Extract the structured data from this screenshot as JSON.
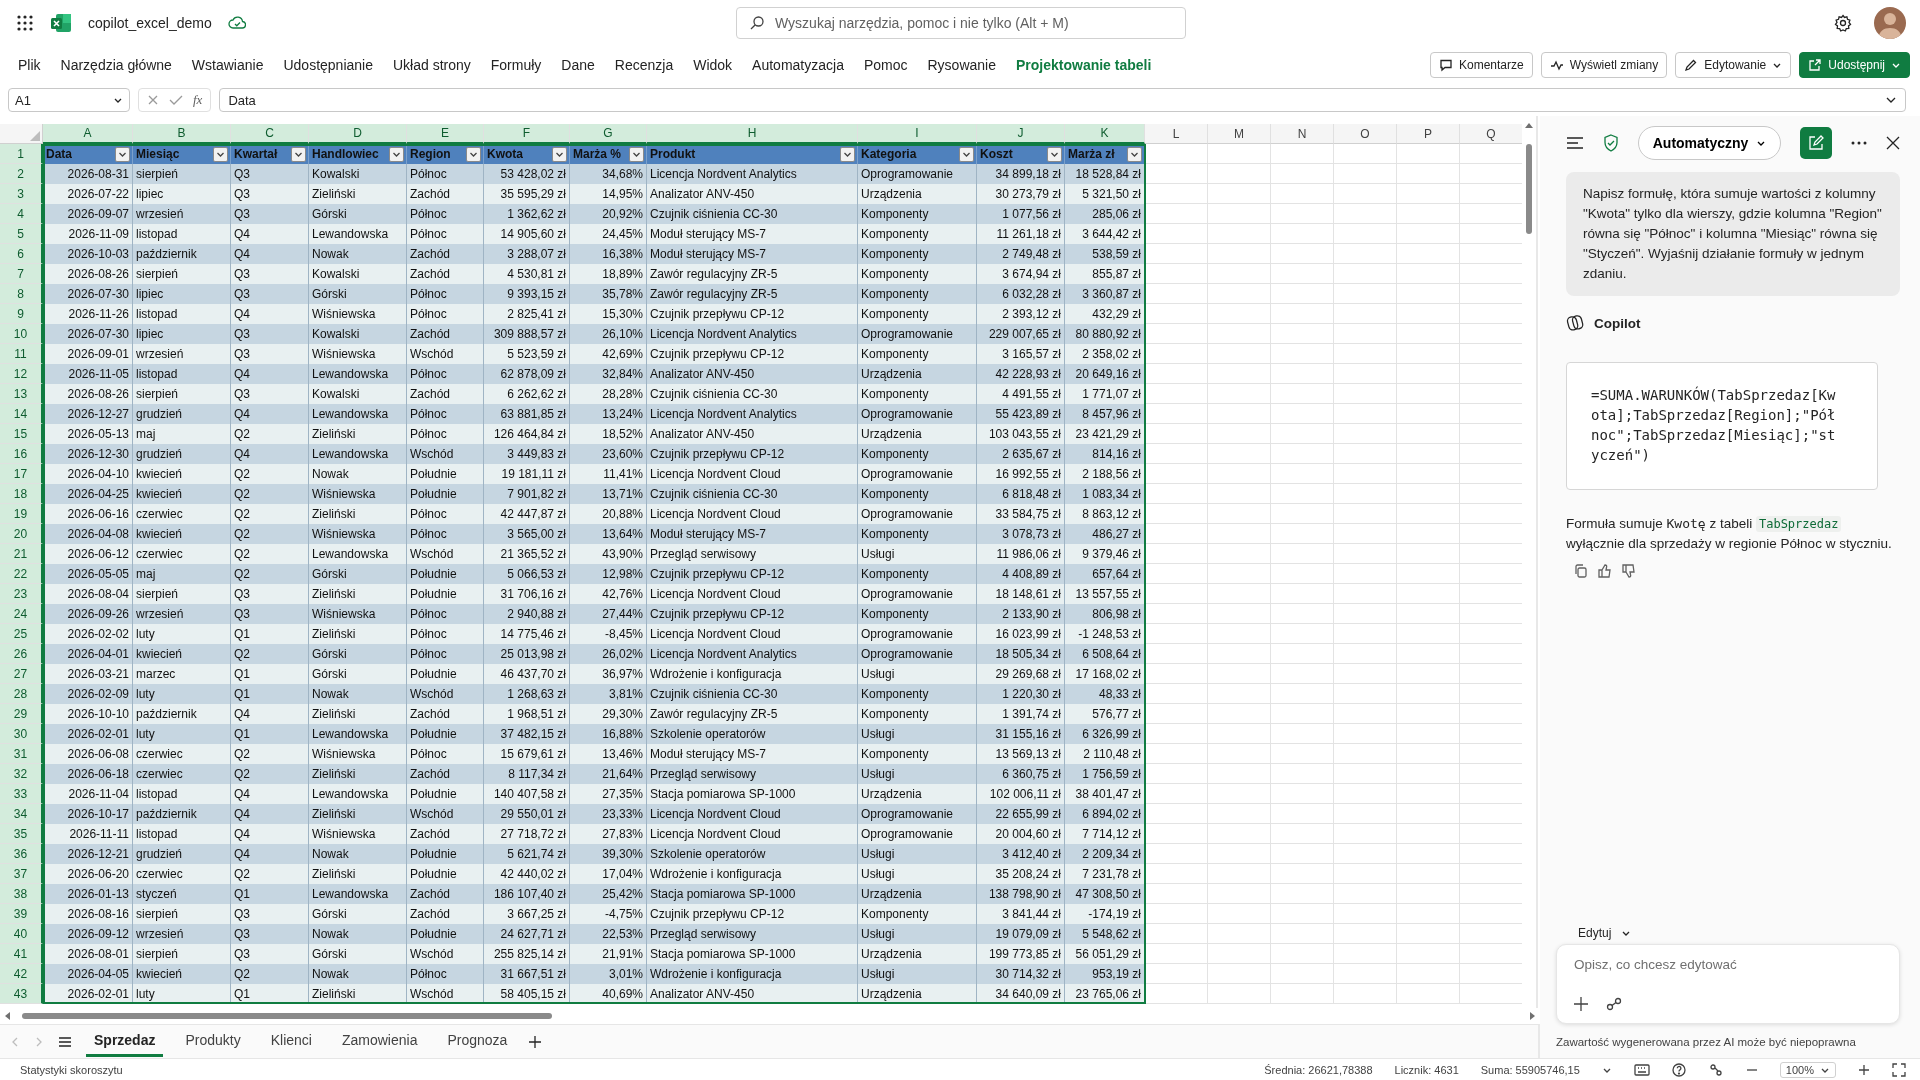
{
  "app": {
    "title": "copilot_excel_demo",
    "search_placeholder": "Wyszukaj narzędzia, pomoc i nie tylko (Alt + M)"
  },
  "ribbon_tabs": [
    {
      "label": "Plik",
      "contextual": false
    },
    {
      "label": "Narzędzia główne",
      "contextual": false
    },
    {
      "label": "Wstawianie",
      "contextual": false
    },
    {
      "label": "Udostępnianie",
      "contextual": false
    },
    {
      "label": "Układ strony",
      "contextual": false
    },
    {
      "label": "Formuły",
      "contextual": false
    },
    {
      "label": "Dane",
      "contextual": false
    },
    {
      "label": "Recenzja",
      "contextual": false
    },
    {
      "label": "Widok",
      "contextual": false
    },
    {
      "label": "Automatyzacja",
      "contextual": false
    },
    {
      "label": "Pomoc",
      "contextual": false
    },
    {
      "label": "Rysowanie",
      "contextual": false
    },
    {
      "label": "Projektowanie tabeli",
      "contextual": true
    }
  ],
  "ribbon_buttons": [
    {
      "label": "Komentarze",
      "kind": "comments",
      "primary": false,
      "dropdown": false
    },
    {
      "label": "Wyświetl zmiany",
      "kind": "changes",
      "primary": false,
      "dropdown": false
    },
    {
      "label": "Edytowanie",
      "kind": "editing",
      "primary": false,
      "dropdown": true
    },
    {
      "label": "Udostępnij",
      "kind": "share",
      "primary": true,
      "dropdown": true
    }
  ],
  "formula_bar": {
    "name_box": "A1",
    "function_label": "fx",
    "formula": "Data"
  },
  "grid": {
    "columns": [
      {
        "label": "A",
        "selected": true
      },
      {
        "label": "B",
        "selected": true
      },
      {
        "label": "C",
        "selected": true
      },
      {
        "label": "D",
        "selected": true
      },
      {
        "label": "E",
        "selected": true
      },
      {
        "label": "F",
        "selected": true
      },
      {
        "label": "G",
        "selected": true
      },
      {
        "label": "H",
        "selected": true
      },
      {
        "label": "I",
        "selected": true
      },
      {
        "label": "J",
        "selected": true
      },
      {
        "label": "K",
        "selected": true
      },
      {
        "label": "L",
        "selected": false
      },
      {
        "label": "M",
        "selected": false
      },
      {
        "label": "N",
        "selected": false
      },
      {
        "label": "O",
        "selected": false
      },
      {
        "label": "P",
        "selected": false
      },
      {
        "label": "Q",
        "selected": false
      }
    ],
    "row_numbers": [
      {
        "label": "1",
        "selected": true
      },
      {
        "label": "2",
        "selected": true
      },
      {
        "label": "3",
        "selected": true
      },
      {
        "label": "4",
        "selected": true
      },
      {
        "label": "5",
        "selected": true
      },
      {
        "label": "6",
        "selected": true
      },
      {
        "label": "7",
        "selected": true
      },
      {
        "label": "8",
        "selected": true
      },
      {
        "label": "9",
        "selected": true
      },
      {
        "label": "10",
        "selected": true
      },
      {
        "label": "11",
        "selected": true
      },
      {
        "label": "12",
        "selected": true
      },
      {
        "label": "13",
        "selected": true
      },
      {
        "label": "14",
        "selected": true
      },
      {
        "label": "15",
        "selected": true
      },
      {
        "label": "16",
        "selected": true
      },
      {
        "label": "17",
        "selected": true
      },
      {
        "label": "18",
        "selected": true
      },
      {
        "label": "19",
        "selected": true
      },
      {
        "label": "20",
        "selected": true
      },
      {
        "label": "21",
        "selected": true
      },
      {
        "label": "22",
        "selected": true
      },
      {
        "label": "23",
        "selected": true
      },
      {
        "label": "24",
        "selected": true
      },
      {
        "label": "25",
        "selected": true
      },
      {
        "label": "26",
        "selected": true
      },
      {
        "label": "27",
        "selected": true
      },
      {
        "label": "28",
        "selected": true
      },
      {
        "label": "29",
        "selected": true
      },
      {
        "label": "30",
        "selected": true
      },
      {
        "label": "31",
        "selected": true
      },
      {
        "label": "32",
        "selected": true
      },
      {
        "label": "33",
        "selected": true
      },
      {
        "label": "34",
        "selected": true
      },
      {
        "label": "35",
        "selected": true
      },
      {
        "label": "36",
        "selected": true
      },
      {
        "label": "37",
        "selected": true
      },
      {
        "label": "38",
        "selected": true
      },
      {
        "label": "39",
        "selected": true
      },
      {
        "label": "40",
        "selected": true
      },
      {
        "label": "41",
        "selected": true
      },
      {
        "label": "42",
        "selected": true
      },
      {
        "label": "43",
        "selected": true
      }
    ]
  },
  "table": {
    "headers": [
      "Data",
      "Miesiąc",
      "Kwartał",
      "Handlowiec",
      "Region",
      "Kwota",
      "Marża %",
      "Produkt",
      "Kategoria",
      "Koszt",
      "Marża zł"
    ],
    "rows": [
      [
        "2026-08-31",
        "sierpień",
        "Q3",
        "Kowalski",
        "Północ",
        "53 428,02 zł",
        "34,68%",
        "Licencja Nordvent Analytics",
        "Oprogramowanie",
        "34 899,18 zł",
        "18 528,84 zł"
      ],
      [
        "2026-07-22",
        "lipiec",
        "Q3",
        "Zieliński",
        "Zachód",
        "35 595,29 zł",
        "14,95%",
        "Analizator ANV-450",
        "Urządzenia",
        "30 273,79 zł",
        "5 321,50 zł"
      ],
      [
        "2026-09-07",
        "wrzesień",
        "Q3",
        "Górski",
        "Północ",
        "1 362,62 zł",
        "20,92%",
        "Czujnik ciśnienia CC-30",
        "Komponenty",
        "1 077,56 zł",
        "285,06 zł"
      ],
      [
        "2026-11-09",
        "listopad",
        "Q4",
        "Lewandowska",
        "Północ",
        "14 905,60 zł",
        "24,45%",
        "Moduł sterujący MS-7",
        "Komponenty",
        "11 261,18 zł",
        "3 644,42 zł"
      ],
      [
        "2026-10-03",
        "październik",
        "Q4",
        "Nowak",
        "Zachód",
        "3 288,07 zł",
        "16,38%",
        "Moduł sterujący MS-7",
        "Komponenty",
        "2 749,48 zł",
        "538,59 zł"
      ],
      [
        "2026-08-26",
        "sierpień",
        "Q3",
        "Kowalski",
        "Zachód",
        "4 530,81 zł",
        "18,89%",
        "Zawór regulacyjny ZR-5",
        "Komponenty",
        "3 674,94 zł",
        "855,87 zł"
      ],
      [
        "2026-07-30",
        "lipiec",
        "Q3",
        "Górski",
        "Północ",
        "9 393,15 zł",
        "35,78%",
        "Zawór regulacyjny ZR-5",
        "Komponenty",
        "6 032,28 zł",
        "3 360,87 zł"
      ],
      [
        "2026-11-26",
        "listopad",
        "Q4",
        "Wiśniewska",
        "Północ",
        "2 825,41 zł",
        "15,30%",
        "Czujnik przepływu CP-12",
        "Komponenty",
        "2 393,12 zł",
        "432,29 zł"
      ],
      [
        "2026-07-30",
        "lipiec",
        "Q3",
        "Kowalski",
        "Zachód",
        "309 888,57 zł",
        "26,10%",
        "Licencja Nordvent Analytics",
        "Oprogramowanie",
        "229 007,65 zł",
        "80 880,92 zł"
      ],
      [
        "2026-09-01",
        "wrzesień",
        "Q3",
        "Wiśniewska",
        "Wschód",
        "5 523,59 zł",
        "42,69%",
        "Czujnik przepływu CP-12",
        "Komponenty",
        "3 165,57 zł",
        "2 358,02 zł"
      ],
      [
        "2026-11-05",
        "listopad",
        "Q4",
        "Lewandowska",
        "Północ",
        "62 878,09 zł",
        "32,84%",
        "Analizator ANV-450",
        "Urządzenia",
        "42 228,93 zł",
        "20 649,16 zł"
      ],
      [
        "2026-08-26",
        "sierpień",
        "Q3",
        "Kowalski",
        "Zachód",
        "6 262,62 zł",
        "28,28%",
        "Czujnik ciśnienia CC-30",
        "Komponenty",
        "4 491,55 zł",
        "1 771,07 zł"
      ],
      [
        "2026-12-27",
        "grudzień",
        "Q4",
        "Lewandowska",
        "Północ",
        "63 881,85 zł",
        "13,24%",
        "Licencja Nordvent Analytics",
        "Oprogramowanie",
        "55 423,89 zł",
        "8 457,96 zł"
      ],
      [
        "2026-05-13",
        "maj",
        "Q2",
        "Zieliński",
        "Północ",
        "126 464,84 zł",
        "18,52%",
        "Analizator ANV-450",
        "Urządzenia",
        "103 043,55 zł",
        "23 421,29 zł"
      ],
      [
        "2026-12-30",
        "grudzień",
        "Q4",
        "Lewandowska",
        "Wschód",
        "3 449,83 zł",
        "23,60%",
        "Czujnik przepływu CP-12",
        "Komponenty",
        "2 635,67 zł",
        "814,16 zł"
      ],
      [
        "2026-04-10",
        "kwiecień",
        "Q2",
        "Nowak",
        "Południe",
        "19 181,11 zł",
        "11,41%",
        "Licencja Nordvent Cloud",
        "Oprogramowanie",
        "16 992,55 zł",
        "2 188,56 zł"
      ],
      [
        "2026-04-25",
        "kwiecień",
        "Q2",
        "Wiśniewska",
        "Południe",
        "7 901,82 zł",
        "13,71%",
        "Czujnik ciśnienia CC-30",
        "Komponenty",
        "6 818,48 zł",
        "1 083,34 zł"
      ],
      [
        "2026-06-16",
        "czerwiec",
        "Q2",
        "Zieliński",
        "Północ",
        "42 447,87 zł",
        "20,88%",
        "Licencja Nordvent Cloud",
        "Oprogramowanie",
        "33 584,75 zł",
        "8 863,12 zł"
      ],
      [
        "2026-04-08",
        "kwiecień",
        "Q2",
        "Wiśniewska",
        "Północ",
        "3 565,00 zł",
        "13,64%",
        "Moduł sterujący MS-7",
        "Komponenty",
        "3 078,73 zł",
        "486,27 zł"
      ],
      [
        "2026-06-12",
        "czerwiec",
        "Q2",
        "Lewandowska",
        "Wschód",
        "21 365,52 zł",
        "43,90%",
        "Przegląd serwisowy",
        "Usługi",
        "11 986,06 zł",
        "9 379,46 zł"
      ],
      [
        "2026-05-05",
        "maj",
        "Q2",
        "Górski",
        "Południe",
        "5 066,53 zł",
        "12,98%",
        "Czujnik przepływu CP-12",
        "Komponenty",
        "4 408,89 zł",
        "657,64 zł"
      ],
      [
        "2026-08-04",
        "sierpień",
        "Q3",
        "Zieliński",
        "Południe",
        "31 706,16 zł",
        "42,76%",
        "Licencja Nordvent Cloud",
        "Oprogramowanie",
        "18 148,61 zł",
        "13 557,55 zł"
      ],
      [
        "2026-09-26",
        "wrzesień",
        "Q3",
        "Wiśniewska",
        "Północ",
        "2 940,88 zł",
        "27,44%",
        "Czujnik przepływu CP-12",
        "Komponenty",
        "2 133,90 zł",
        "806,98 zł"
      ],
      [
        "2026-02-02",
        "luty",
        "Q1",
        "Zieliński",
        "Północ",
        "14 775,46 zł",
        "-8,45%",
        "Licencja Nordvent Cloud",
        "Oprogramowanie",
        "16 023,99 zł",
        "-1 248,53 zł"
      ],
      [
        "2026-04-01",
        "kwiecień",
        "Q2",
        "Górski",
        "Północ",
        "25 013,98 zł",
        "26,02%",
        "Licencja Nordvent Analytics",
        "Oprogramowanie",
        "18 505,34 zł",
        "6 508,64 zł"
      ],
      [
        "2026-03-21",
        "marzec",
        "Q1",
        "Górski",
        "Południe",
        "46 437,70 zł",
        "36,97%",
        "Wdrożenie i konfiguracja",
        "Usługi",
        "29 269,68 zł",
        "17 168,02 zł"
      ],
      [
        "2026-02-09",
        "luty",
        "Q1",
        "Nowak",
        "Wschód",
        "1 268,63 zł",
        "3,81%",
        "Czujnik ciśnienia CC-30",
        "Komponenty",
        "1 220,30 zł",
        "48,33 zł"
      ],
      [
        "2026-10-10",
        "październik",
        "Q4",
        "Zieliński",
        "Zachód",
        "1 968,51 zł",
        "29,30%",
        "Zawór regulacyjny ZR-5",
        "Komponenty",
        "1 391,74 zł",
        "576,77 zł"
      ],
      [
        "2026-02-01",
        "luty",
        "Q1",
        "Lewandowska",
        "Południe",
        "37 482,15 zł",
        "16,88%",
        "Szkolenie operatorów",
        "Usługi",
        "31 155,16 zł",
        "6 326,99 zł"
      ],
      [
        "2026-06-08",
        "czerwiec",
        "Q2",
        "Wiśniewska",
        "Północ",
        "15 679,61 zł",
        "13,46%",
        "Moduł sterujący MS-7",
        "Komponenty",
        "13 569,13 zł",
        "2 110,48 zł"
      ],
      [
        "2026-06-18",
        "czerwiec",
        "Q2",
        "Zieliński",
        "Zachód",
        "8 117,34 zł",
        "21,64%",
        "Przegląd serwisowy",
        "Usługi",
        "6 360,75 zł",
        "1 756,59 zł"
      ],
      [
        "2026-11-04",
        "listopad",
        "Q4",
        "Lewandowska",
        "Południe",
        "140 407,58 zł",
        "27,35%",
        "Stacja pomiarowa SP-1000",
        "Urządzenia",
        "102 006,11 zł",
        "38 401,47 zł"
      ],
      [
        "2026-10-17",
        "październik",
        "Q4",
        "Zieliński",
        "Wschód",
        "29 550,01 zł",
        "23,33%",
        "Licencja Nordvent Cloud",
        "Oprogramowanie",
        "22 655,99 zł",
        "6 894,02 zł"
      ],
      [
        "2026-11-11",
        "listopad",
        "Q4",
        "Wiśniewska",
        "Zachód",
        "27 718,72 zł",
        "27,83%",
        "Licencja Nordvent Cloud",
        "Oprogramowanie",
        "20 004,60 zł",
        "7 714,12 zł"
      ],
      [
        "2026-12-21",
        "grudzień",
        "Q4",
        "Nowak",
        "Południe",
        "5 621,74 zł",
        "39,30%",
        "Szkolenie operatorów",
        "Usługi",
        "3 412,40 zł",
        "2 209,34 zł"
      ],
      [
        "2026-06-20",
        "czerwiec",
        "Q2",
        "Zieliński",
        "Południe",
        "42 440,02 zł",
        "17,04%",
        "Wdrożenie i konfiguracja",
        "Usługi",
        "35 208,24 zł",
        "7 231,78 zł"
      ],
      [
        "2026-01-13",
        "styczeń",
        "Q1",
        "Lewandowska",
        "Zachód",
        "186 107,40 zł",
        "25,42%",
        "Stacja pomiarowa SP-1000",
        "Urządzenia",
        "138 798,90 zł",
        "47 308,50 zł"
      ],
      [
        "2026-08-16",
        "sierpień",
        "Q3",
        "Górski",
        "Zachód",
        "3 667,25 zł",
        "-4,75%",
        "Czujnik przepływu CP-12",
        "Komponenty",
        "3 841,44 zł",
        "-174,19 zł"
      ],
      [
        "2026-09-12",
        "wrzesień",
        "Q3",
        "Nowak",
        "Południe",
        "24 627,71 zł",
        "22,53%",
        "Przegląd serwisowy",
        "Usługi",
        "19 079,09 zł",
        "5 548,62 zł"
      ],
      [
        "2026-08-01",
        "sierpień",
        "Q3",
        "Górski",
        "Wschód",
        "255 825,14 zł",
        "21,91%",
        "Stacja pomiarowa SP-1000",
        "Urządzenia",
        "199 773,85 zł",
        "56 051,29 zł"
      ],
      [
        "2026-04-05",
        "kwiecień",
        "Q2",
        "Nowak",
        "Północ",
        "31 667,51 zł",
        "3,01%",
        "Wdrożenie i konfiguracja",
        "Usługi",
        "30 714,32 zł",
        "953,19 zł"
      ],
      [
        "2026-02-01",
        "luty",
        "Q1",
        "Zieliński",
        "Wschód",
        "58 405,15 zł",
        "40,69%",
        "Analizator ANV-450",
        "Urządzenia",
        "34 640,09 zł",
        "23 765,06 zł"
      ]
    ]
  },
  "sheet_tabs": [
    {
      "label": "Sprzedaz",
      "selected": true
    },
    {
      "label": "Produkty",
      "selected": false
    },
    {
      "label": "Klienci",
      "selected": false
    },
    {
      "label": "Zamowienia",
      "selected": false
    },
    {
      "label": "Prognoza",
      "selected": false
    }
  ],
  "copilot": {
    "mode": "Automatyczny",
    "user_message": "Napisz formułę, która sumuje wartości z kolumny \"Kwota\" tylko dla wierszy, gdzie kolumna \"Region\" równa się \"Północ\" i kolumna \"Miesiąc\" równa się \"Styczeń\". Wyjaśnij działanie formuły w jednym zdaniu.",
    "assistant_name": "Copilot",
    "code": "=SUMA.WARUNKÓW(TabSprzedaz[Kwota];TabSprzedaz[Region];\"Północ\";TabSprzedaz[Miesiąc];\"styczeń\")",
    "answer": [
      {
        "text": "Formuła sumuje ",
        "kind": "plain"
      },
      {
        "text": "Kwotę",
        "kind": "code"
      },
      {
        "text": " z tabeli ",
        "kind": "plain"
      },
      {
        "text": "TabSprzedaz",
        "kind": "table_ref"
      },
      {
        "text": " wyłącznie dla sprzedaży w regionie Północ w styczniu.",
        "kind": "plain"
      }
    ],
    "edit_label": "Edytuj",
    "input_placeholder": "Opisz, co chcesz edytować",
    "disclaimer": "Zawartość wygenerowana przez AI może być niepoprawna"
  },
  "status_bar": {
    "label": "Statystyki skoroszytu",
    "stats": [
      "Średnia: 26621,78388",
      "Licznik: 4631",
      "Suma: 55905746,15"
    ],
    "zoom": "100%"
  }
}
